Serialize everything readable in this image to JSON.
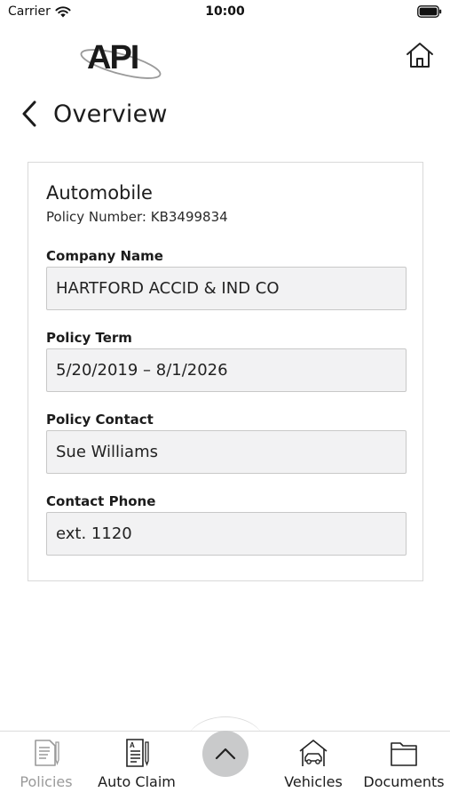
{
  "status_bar": {
    "carrier": "Carrier",
    "time": "10:00",
    "icons": [
      "wifi-icon",
      "battery-icon"
    ]
  },
  "header": {
    "logo_text": "API",
    "home_icon": "home-icon",
    "back_icon": "chevron-left-icon",
    "title": "Overview"
  },
  "policy": {
    "type": "Automobile",
    "number_label": "Policy Number: KB3499834",
    "fields": [
      {
        "label": "Company Name",
        "value": "HARTFORD ACCID & IND CO"
      },
      {
        "label": "Policy Term",
        "value": "5/20/2019 – 8/1/2026"
      },
      {
        "label": "Policy Contact",
        "value": "Sue Williams"
      },
      {
        "label": "Contact Phone",
        "value": "ext. 1120"
      }
    ]
  },
  "bottom_nav": {
    "items": [
      {
        "label": "Policies",
        "icon": "policies-icon",
        "state": "disabled"
      },
      {
        "label": "Auto Claim",
        "icon": "auto-claim-icon",
        "state": "normal"
      },
      {
        "label": "Vehicles",
        "icon": "vehicles-icon",
        "state": "normal"
      },
      {
        "label": "Documents",
        "icon": "documents-icon",
        "state": "normal"
      }
    ],
    "expand_icon": "chevron-up-icon"
  },
  "colors": {
    "field_background": "#f2f2f3",
    "field_border": "#c8c8c8",
    "disabled_text": "#9a9a9a",
    "expand_button": "#c9cacb"
  }
}
